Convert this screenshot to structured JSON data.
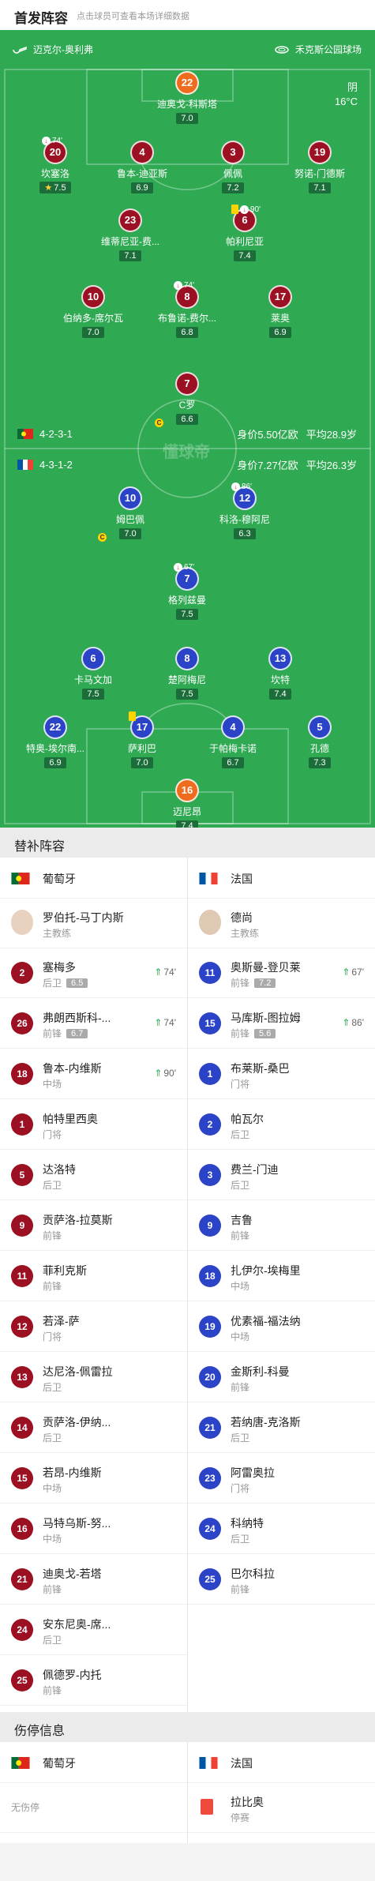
{
  "header": {
    "title": "首发阵容",
    "subtitle": "点击球员可查看本场详细数据"
  },
  "pitch": {
    "home_team": "迈克尔-奥利弗",
    "stadium": "禾克斯公园球场",
    "weather": "阴",
    "temperature": "16°C",
    "watermark": "懂球帝",
    "home_formation": "4-2-3-1",
    "home_value": "身价5.50亿欧",
    "home_age": "平均28.9岁",
    "away_formation": "4-3-1-2",
    "away_value": "身价7.27亿欧",
    "away_age": "平均26.3岁"
  },
  "home_players": [
    {
      "num": "22",
      "name": "迪奥戈-科斯塔",
      "rating": "7.0",
      "gk": true
    },
    {
      "num": "20",
      "name": "坎塞洛",
      "rating": "7.5",
      "star": true,
      "sub": "74'"
    },
    {
      "num": "4",
      "name": "鲁本-迪亚斯",
      "rating": "6.9"
    },
    {
      "num": "3",
      "name": "佩佩",
      "rating": "7.2"
    },
    {
      "num": "19",
      "name": "努诺-门德斯",
      "rating": "7.1"
    },
    {
      "num": "23",
      "name": "维蒂尼亚-费...",
      "rating": "7.1"
    },
    {
      "num": "6",
      "name": "帕利尼亚",
      "rating": "7.4",
      "sub": "90'",
      "yellow": true
    },
    {
      "num": "10",
      "name": "伯纳多-席尔瓦",
      "rating": "7.0"
    },
    {
      "num": "8",
      "name": "布鲁诺-费尔...",
      "rating": "6.8",
      "sub": "74'"
    },
    {
      "num": "17",
      "name": "莱奥",
      "rating": "6.9"
    },
    {
      "num": "7",
      "name": "C罗",
      "rating": "6.6",
      "captain": true
    }
  ],
  "away_players": [
    {
      "num": "10",
      "name": "姆巴佩",
      "rating": "7.0",
      "captain": true
    },
    {
      "num": "12",
      "name": "科洛-穆阿尼",
      "rating": "6.3",
      "sub": "86'"
    },
    {
      "num": "7",
      "name": "格列兹曼",
      "rating": "7.5",
      "sub": "67'"
    },
    {
      "num": "6",
      "name": "卡马文加",
      "rating": "7.5"
    },
    {
      "num": "8",
      "name": "楚阿梅尼",
      "rating": "7.5"
    },
    {
      "num": "13",
      "name": "坎特",
      "rating": "7.4"
    },
    {
      "num": "22",
      "name": "特奥-埃尔南...",
      "rating": "6.9"
    },
    {
      "num": "17",
      "name": "萨利巴",
      "rating": "7.0",
      "yellow": true
    },
    {
      "num": "4",
      "name": "于帕梅卡诺",
      "rating": "6.7"
    },
    {
      "num": "5",
      "name": "孔德",
      "rating": "7.3"
    },
    {
      "num": "16",
      "name": "迈尼昂",
      "rating": "7.4",
      "gk": true
    }
  ],
  "subs_section": {
    "title": "替补阵容"
  },
  "home_team_name": "葡萄牙",
  "away_team_name": "法国",
  "home_coach": {
    "name": "罗伯托-马丁内斯",
    "role": "主教练"
  },
  "away_coach": {
    "name": "德尚",
    "role": "主教练"
  },
  "home_subs": [
    {
      "num": "2",
      "name": "塞梅多",
      "pos": "后卫",
      "rating": "6.5",
      "in": "74'"
    },
    {
      "num": "26",
      "name": "弗朗西斯科-...",
      "pos": "前锋",
      "rating": "6.7",
      "in": "74'"
    },
    {
      "num": "18",
      "name": "鲁本-内维斯",
      "pos": "中场",
      "in": "90'"
    },
    {
      "num": "1",
      "name": "帕特里西奥",
      "pos": "门将"
    },
    {
      "num": "5",
      "name": "达洛特",
      "pos": "后卫"
    },
    {
      "num": "9",
      "name": "贡萨洛-拉莫斯",
      "pos": "前锋"
    },
    {
      "num": "11",
      "name": "菲利克斯",
      "pos": "前锋"
    },
    {
      "num": "12",
      "name": "若泽-萨",
      "pos": "门将"
    },
    {
      "num": "13",
      "name": "达尼洛-佩雷拉",
      "pos": "后卫"
    },
    {
      "num": "14",
      "name": "贡萨洛-伊纳...",
      "pos": "后卫"
    },
    {
      "num": "15",
      "name": "若昂-内维斯",
      "pos": "中场"
    },
    {
      "num": "16",
      "name": "马特乌斯-努...",
      "pos": "中场"
    },
    {
      "num": "21",
      "name": "迪奥戈-若塔",
      "pos": "前锋"
    },
    {
      "num": "24",
      "name": "安东尼奥-席...",
      "pos": "后卫"
    },
    {
      "num": "25",
      "name": "佩德罗-内托",
      "pos": "前锋"
    }
  ],
  "away_subs": [
    {
      "num": "11",
      "name": "奥斯曼-登贝莱",
      "pos": "前锋",
      "rating": "7.2",
      "in": "67'"
    },
    {
      "num": "15",
      "name": "马库斯-图拉姆",
      "pos": "前锋",
      "rating": "5.6",
      "in": "86'"
    },
    {
      "num": "1",
      "name": "布莱斯-桑巴",
      "pos": "门将"
    },
    {
      "num": "2",
      "name": "帕瓦尔",
      "pos": "后卫"
    },
    {
      "num": "3",
      "name": "费兰-门迪",
      "pos": "后卫"
    },
    {
      "num": "9",
      "name": "吉鲁",
      "pos": "前锋"
    },
    {
      "num": "18",
      "name": "扎伊尔-埃梅里",
      "pos": "中场"
    },
    {
      "num": "19",
      "name": "优素福-福法纳",
      "pos": "中场"
    },
    {
      "num": "20",
      "name": "金斯利-科曼",
      "pos": "前锋"
    },
    {
      "num": "21",
      "name": "若纳唐-克洛斯",
      "pos": "后卫"
    },
    {
      "num": "23",
      "name": "阿雷奥拉",
      "pos": "门将"
    },
    {
      "num": "24",
      "name": "科纳特",
      "pos": "后卫"
    },
    {
      "num": "25",
      "name": "巴尔科拉",
      "pos": "前锋"
    }
  ],
  "injury_section": {
    "title": "伤停信息"
  },
  "home_injury": "无伤停",
  "away_injury": {
    "name": "拉比奥",
    "status": "停赛"
  },
  "colors": {
    "pitch": "#2faa53",
    "home": "#9b1022",
    "away": "#2a43c7",
    "keeper": "#ef6c1e"
  }
}
